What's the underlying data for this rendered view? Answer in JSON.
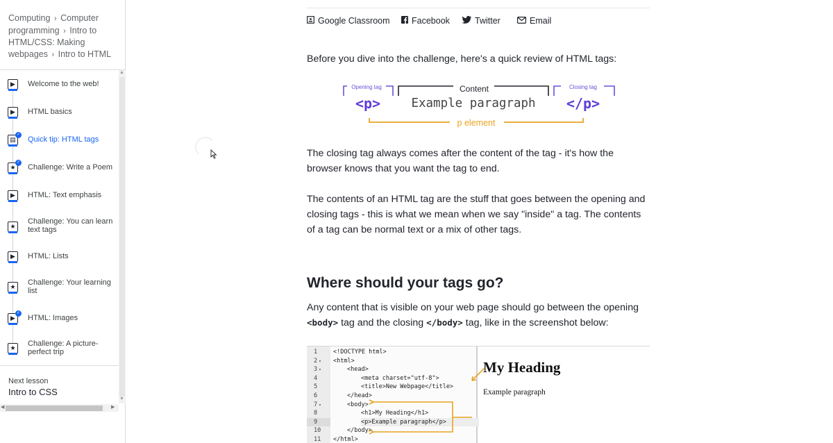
{
  "sidebar": {
    "breadcrumb": [
      "Computing",
      "Computer programming",
      "Intro to HTML/CSS: Making webpages",
      "Intro to HTML"
    ],
    "breadcrumb_sep": "›",
    "items": [
      {
        "label": "Welcome to the web!",
        "type": "video",
        "icon": "play-icon",
        "completed": false,
        "active": false
      },
      {
        "label": "HTML basics",
        "type": "video",
        "icon": "play-icon",
        "completed": false,
        "active": false
      },
      {
        "label": "Quick tip: HTML tags",
        "type": "article",
        "icon": "article-icon",
        "completed": true,
        "active": true
      },
      {
        "label": "Challenge: Write a Poem",
        "type": "challenge",
        "icon": "star-icon",
        "completed": true,
        "active": false
      },
      {
        "label": "HTML: Text emphasis",
        "type": "video",
        "icon": "play-icon",
        "completed": false,
        "active": false
      },
      {
        "label": "Challenge: You can learn text tags",
        "type": "challenge",
        "icon": "star-icon",
        "completed": false,
        "active": false
      },
      {
        "label": "HTML: Lists",
        "type": "video",
        "icon": "play-icon",
        "completed": false,
        "active": false
      },
      {
        "label": "Challenge: Your learning list",
        "type": "challenge",
        "icon": "star-icon",
        "completed": false,
        "active": false
      },
      {
        "label": "HTML: Images",
        "type": "video",
        "icon": "play-icon",
        "completed": true,
        "active": false
      },
      {
        "label": "Challenge: A picture-perfect trip",
        "type": "challenge",
        "icon": "star-icon",
        "completed": false,
        "active": false
      }
    ],
    "next_caption": "Next lesson",
    "next_title": "Intro to CSS"
  },
  "share": [
    {
      "label": "Google Classroom",
      "icon": "google-classroom-icon"
    },
    {
      "label": "Facebook",
      "icon": "facebook-icon"
    },
    {
      "label": "Twitter",
      "icon": "twitter-icon"
    },
    {
      "label": "Email",
      "icon": "email-icon"
    }
  ],
  "content": {
    "intro": "Before you dive into the challenge, here's a quick review of HTML tags:",
    "diagram": {
      "opening_caption": "Opening tag",
      "content_caption": "Content",
      "closing_caption": "Closing tag",
      "open_tag": "<p>",
      "content_text": "Example paragraph",
      "close_tag": "</p>",
      "element_caption": "p element"
    },
    "para1": "The closing tag always comes after the content of the tag - it's how the browser knows that you want the tag to end.",
    "para2": "The contents of an HTML tag are the stuff that goes between the opening and closing tags - this is what we mean when we say \"inside\" a tag. The contents of a tag can be normal text or a mix of other tags.",
    "heading": "Where should your tags go?",
    "para3_start": "Any content that is visible on your web page should go between the opening ",
    "para3_code1": "<body>",
    "para3_mid": " tag and the closing ",
    "para3_code2": "</body>",
    "para3_end": " tag, like in the screenshot below:"
  },
  "editor": {
    "line_numbers": [
      "1",
      "2",
      "3",
      "4",
      "5",
      "6",
      "7",
      "8",
      "9",
      "10",
      "11"
    ],
    "folds": [
      "",
      "▾",
      "▾",
      "",
      "",
      "",
      "▾",
      "",
      "",
      "",
      ""
    ],
    "lines": [
      "<!DOCTYPE html>",
      "<html>",
      "<head>",
      "<meta charset=\"utf-8\">",
      "<title>New Webpage</title>",
      "</head>",
      "<body>",
      "<h1>My Heading</h1>",
      "<p>Example paragraph</p>",
      "</body>",
      "</html>"
    ],
    "indent": [
      0,
      0,
      1,
      2,
      2,
      1,
      1,
      2,
      2,
      1,
      0
    ],
    "highlight_line": 9
  },
  "preview": {
    "heading": "My Heading",
    "paragraph": "Example paragraph"
  },
  "colors": {
    "accent_blue": "#1865f2",
    "tag_purple": "#5e3bd6",
    "element_orange": "#e8a321",
    "text": "#21242c"
  }
}
